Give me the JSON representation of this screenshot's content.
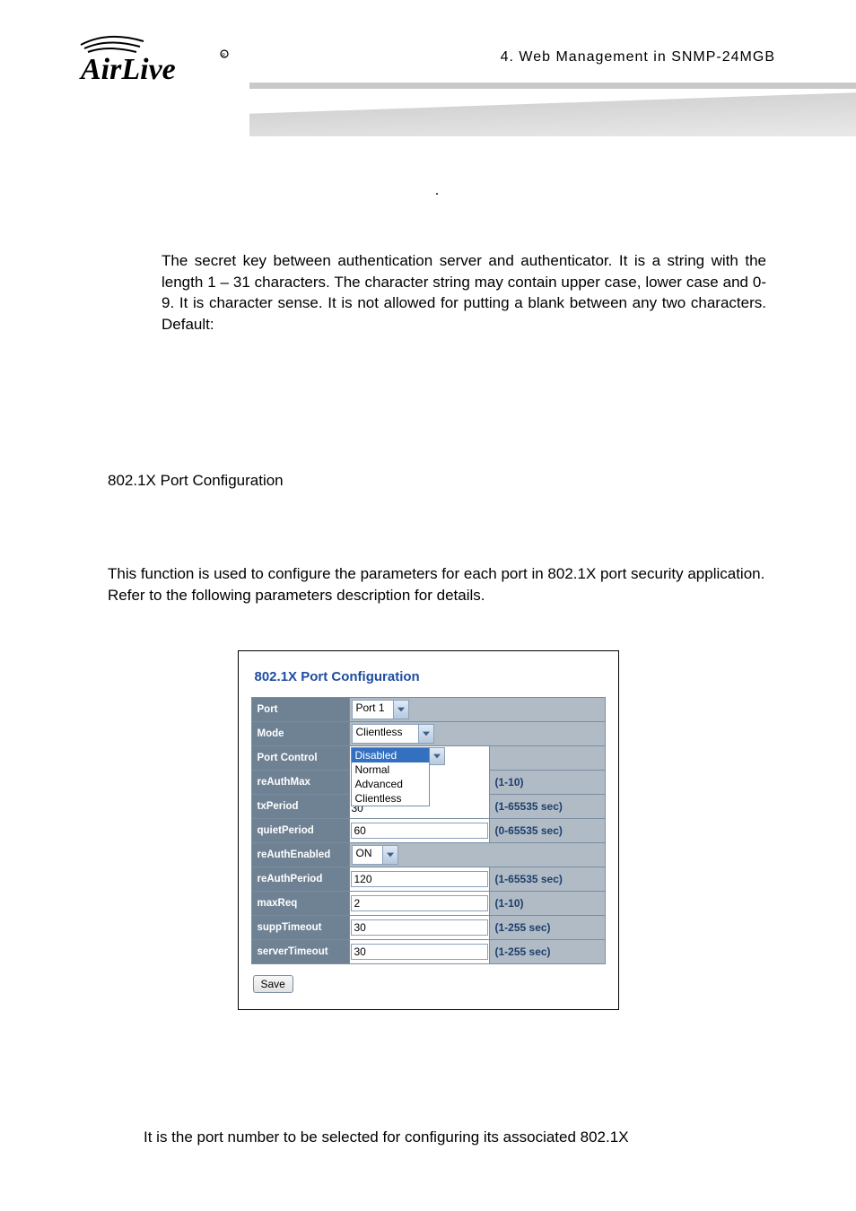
{
  "chapter": "4.  Web Management in SNMP-24MGB",
  "logo_text": "AirLive",
  "dot": ".",
  "para_secret": "The secret key between authentication server and authenticator. It is a string with the length 1 – 31 characters. The character string may contain upper case, lower case and 0-9. It is character sense. It is not allowed for putting a blank between any two characters. Default:",
  "subheading": "802.1X Port Configuration",
  "para_func": "This function is used to configure the parameters for each port in 802.1X port security application. Refer to the following parameters description for details.",
  "shot": {
    "title": "802.1X Port Configuration",
    "rows": {
      "port": {
        "label": "Port",
        "value": "Port 1",
        "type": "select"
      },
      "mode": {
        "label": "Mode",
        "value": "Clientless",
        "type": "select"
      },
      "portControl": {
        "label": "Port Control",
        "type": "listbox",
        "options": [
          "Disabled",
          "Normal",
          "Advanced",
          "Clientless"
        ],
        "selected": "Disabled",
        "under_value": "30"
      },
      "reAuthMax": {
        "label": "reAuthMax",
        "range": "(1-10)"
      },
      "txPeriod": {
        "label": "txPeriod",
        "range": "(1-65535 sec)"
      },
      "quietPeriod": {
        "label": "quietPeriod",
        "value": "60",
        "range": "(0-65535 sec)"
      },
      "reAuthEnabled": {
        "label": "reAuthEnabled",
        "value": "ON",
        "type": "select"
      },
      "reAuthPeriod": {
        "label": "reAuthPeriod",
        "value": "120",
        "range": "(1-65535 sec)"
      },
      "maxReq": {
        "label": "maxReq",
        "value": "2",
        "range": "(1-10)"
      },
      "suppTimeout": {
        "label": "suppTimeout",
        "value": "30",
        "range": "(1-255 sec)"
      },
      "serverTimeout": {
        "label": "serverTimeout",
        "value": "30",
        "range": "(1-255 sec)"
      }
    },
    "save_label": "Save"
  },
  "para_after": "It is the port number to be selected for configuring its associated 802.1X"
}
